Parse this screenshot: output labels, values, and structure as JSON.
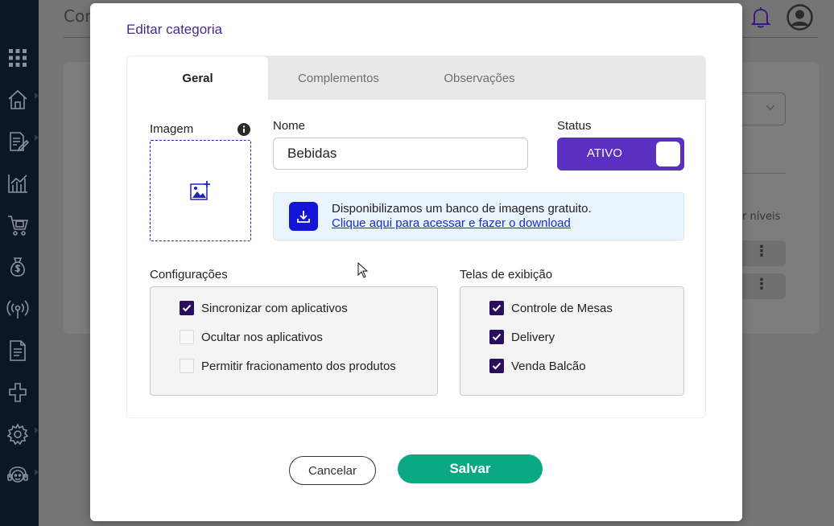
{
  "background": {
    "page_title": "Con",
    "side_text": "r níveis",
    "sidebar_icons": [
      "apps-grid-icon",
      "home-icon",
      "document-edit-icon",
      "chart-icon",
      "cart-icon",
      "money-bag-icon",
      "broadcast-icon",
      "receipt-icon",
      "integration-icon",
      "settings-icon",
      "support-icon"
    ],
    "header_icons": [
      "bell-icon",
      "user-avatar-icon"
    ]
  },
  "modal": {
    "title": "Editar categoria",
    "tabs": [
      {
        "label": "Geral",
        "active": true
      },
      {
        "label": "Complementos",
        "active": false
      },
      {
        "label": "Observações",
        "active": false
      }
    ],
    "image": {
      "label": "Imagem",
      "info_icon": "info-icon",
      "placeholder_icon": "add-image-icon"
    },
    "name": {
      "label": "Nome",
      "value": "Bebidas"
    },
    "status": {
      "label": "Status",
      "value": "ATIVO",
      "on": true
    },
    "banner": {
      "text": "Disponibilizamos um banco de imagens gratuito.",
      "link": "Clique aqui para acessar e fazer o download",
      "icon": "download-icon"
    },
    "configuracoes": {
      "title": "Configurações",
      "options": [
        {
          "label": "Sincronizar com aplicativos",
          "checked": true
        },
        {
          "label": "Ocultar nos aplicativos",
          "checked": false
        },
        {
          "label": "Permitir fracionamento dos produtos",
          "checked": false
        }
      ]
    },
    "telas": {
      "title": "Telas de exibição",
      "options": [
        {
          "label": "Controle de Mesas",
          "checked": true
        },
        {
          "label": "Delivery",
          "checked": true
        },
        {
          "label": "Venda Balcão",
          "checked": true
        }
      ]
    },
    "buttons": {
      "cancel": "Cancelar",
      "save": "Salvar"
    }
  },
  "colors": {
    "accent": "#5a2fc2",
    "title": "#4a2a8f",
    "save": "#0aa984",
    "checkbox": "#2a0d5e",
    "link": "#1a2bd0"
  }
}
